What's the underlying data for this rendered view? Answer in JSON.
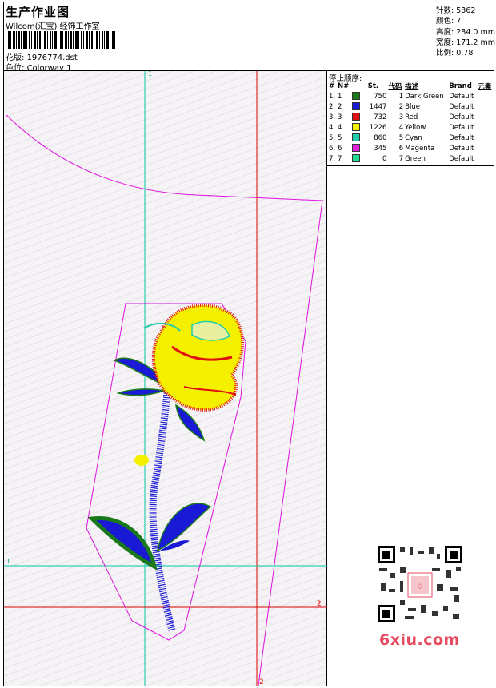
{
  "header": {
    "title": "生产作业图",
    "company": "Wilcom(汇宝) 经饰工作室",
    "design_label": "花版:",
    "design_value": "1976774.dst",
    "colorway_label": "色位:",
    "colorway_value": "Colorway 1"
  },
  "stats": {
    "stitches_label": "针数:",
    "stitches_value": "5362",
    "colors_label": "颜色:",
    "colors_value": "7",
    "height_label": "高度:",
    "height_value": "284.0 mm",
    "width_label": "宽度:",
    "width_value": "171.2 mm",
    "scale_label": "比例:",
    "scale_value": "0.78"
  },
  "stop_panel": {
    "title": "停止顺序:",
    "columns": [
      "#",
      "N#",
      "St.",
      "代码",
      "描述",
      "Brand",
      "元素"
    ],
    "rows": [
      {
        "idx": "1.",
        "n": "1",
        "st": "750",
        "code": "1",
        "desc": "Dark Green",
        "brand": "Default",
        "color": "#1a7a1a"
      },
      {
        "idx": "2.",
        "n": "2",
        "st": "1447",
        "code": "2",
        "desc": "Blue",
        "brand": "Default",
        "color": "#1a1ad6"
      },
      {
        "idx": "3.",
        "n": "3",
        "st": "732",
        "code": "3",
        "desc": "Red",
        "brand": "Default",
        "color": "#e01010"
      },
      {
        "idx": "4.",
        "n": "4",
        "st": "1226",
        "code": "4",
        "desc": "Yellow",
        "brand": "Default",
        "color": "#f5f000"
      },
      {
        "idx": "5.",
        "n": "5",
        "st": "860",
        "code": "5",
        "desc": "Cyan",
        "brand": "Default",
        "color": "#22ccaa"
      },
      {
        "idx": "6.",
        "n": "6",
        "st": "345",
        "code": "6",
        "desc": "Magenta",
        "brand": "Default",
        "color": "#e020e0"
      },
      {
        "idx": "7.",
        "n": "7",
        "st": "0",
        "code": "7",
        "desc": "Green",
        "brand": "Default",
        "color": "#22d890"
      }
    ]
  },
  "canvas": {
    "guide_v1_label": "1",
    "guide_h1_label": "1",
    "guide_h2_label": "2",
    "guide_v2_label": "2",
    "colors": {
      "cyan_guide": "#00c8a0",
      "red_guide": "#e00000",
      "outline": "#e010e0"
    }
  },
  "watermark": {
    "text": "6xiu.com"
  }
}
